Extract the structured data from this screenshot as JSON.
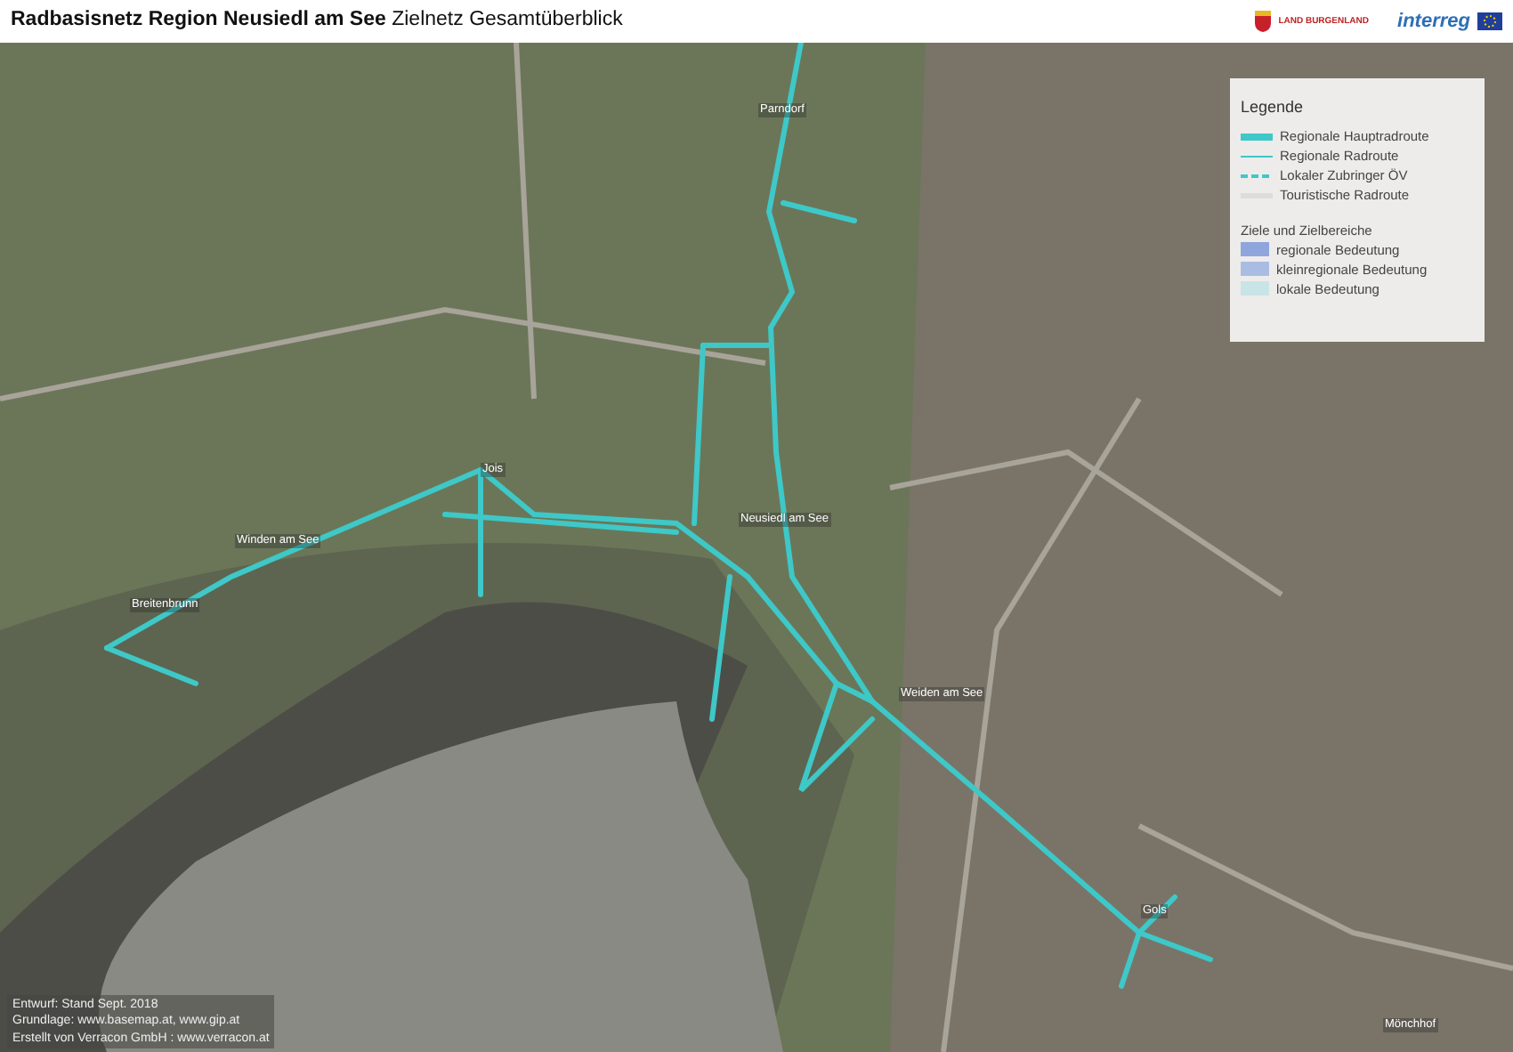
{
  "header": {
    "title": "**Radbasisnetz Region Neusiedl am See** Zielnetz Gesamtüberblick",
    "logos": [
      {
        "kind": "coat",
        "text": "LAND BURGENLAND"
      },
      {
        "kind": "interreg",
        "text": "interreg"
      }
    ]
  },
  "map": {
    "places": [
      {
        "name": "Parndorf",
        "kind": "town"
      },
      {
        "name": "Jois",
        "kind": "town"
      },
      {
        "name": "Winden am See",
        "kind": "town"
      },
      {
        "name": "Breitenbrunn",
        "kind": "town"
      },
      {
        "name": "Neusiedl am See",
        "kind": "town"
      },
      {
        "name": "Weiden am See",
        "kind": "town"
      },
      {
        "name": "Gols",
        "kind": "town"
      },
      {
        "name": "Mönchhof",
        "kind": "town"
      }
    ],
    "legend": {
      "title": "Legende",
      "lines": [
        {
          "label": "Regionale Hauptradroute",
          "kind": "main"
        },
        {
          "label": "Regionale Radroute",
          "kind": "thin"
        },
        {
          "label": "Lokaler Zubringer ÖV",
          "kind": "dashed"
        },
        {
          "label": "Touristische Radroute",
          "kind": "tourist"
        }
      ],
      "areas_title": "Ziele und Zielbereiche",
      "areas": [
        {
          "label": "regionale Bedeutung",
          "color": "#8ea6dc"
        },
        {
          "label": "kleinregionale Bedeutung",
          "color": "#a9bde3"
        },
        {
          "label": "lokale Bedeutung",
          "color": "#c8e4e6"
        }
      ]
    },
    "credits": [
      "Entwurf: Stand Sept. 2018",
      "Grundlage: www.basemap.at, www.gip.at",
      "Erstellt von Verracon GmbH : www.verracon.at"
    ]
  }
}
